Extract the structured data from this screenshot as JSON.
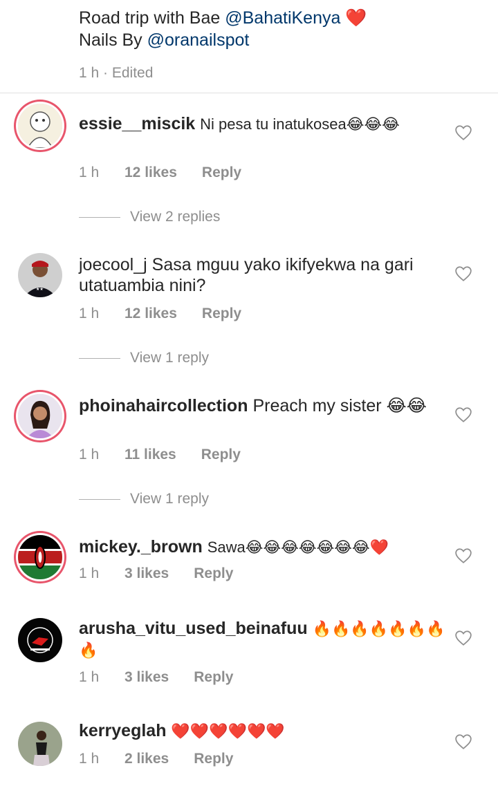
{
  "caption": {
    "line1_text": "Road trip with Bae",
    "line1_mention": "@BahatiKenya",
    "line1_emoji": "❤️",
    "line2_text": "Nails By",
    "line2_mention": "@oranailspot",
    "meta": "1 h · Edited"
  },
  "comments": [
    {
      "username": "essie__miscik",
      "text": "Ni pesa tu inatukosea😂😂😂",
      "time": "1 h",
      "likes": "12 likes",
      "reply": "Reply",
      "view_replies": "View 2 replies"
    },
    {
      "username": "joecool_j",
      "text": "Sasa mguu yako ikifyekwa na gari utatuambia nini?",
      "time": "1 h",
      "likes": "12 likes",
      "reply": "Reply",
      "view_replies": "View 1 reply"
    },
    {
      "username": "phoinahaircollection",
      "text": "Preach my sister 😂😂",
      "time": "1 h",
      "likes": "11 likes",
      "reply": "Reply",
      "view_replies": "View 1 reply"
    },
    {
      "username": "mickey._brown",
      "text": "Sawa😂😂😂😂😂😂😂❤️",
      "time": "1 h",
      "likes": "3 likes",
      "reply": "Reply"
    },
    {
      "username": "arusha_vitu_used_beinafuu",
      "text": "🔥🔥🔥🔥🔥🔥🔥🔥",
      "time": "1 h",
      "likes": "3 likes",
      "reply": "Reply"
    },
    {
      "username": "kerryeglah",
      "text": "❤️❤️❤️❤️❤️❤️",
      "time": "1 h",
      "likes": "2 likes",
      "reply": "Reply"
    }
  ],
  "icons": {
    "like": "heart-outline-icon"
  },
  "colors": {
    "mention": "#00376b",
    "muted": "#8e8e8e",
    "story_ring": "#e8556b"
  }
}
